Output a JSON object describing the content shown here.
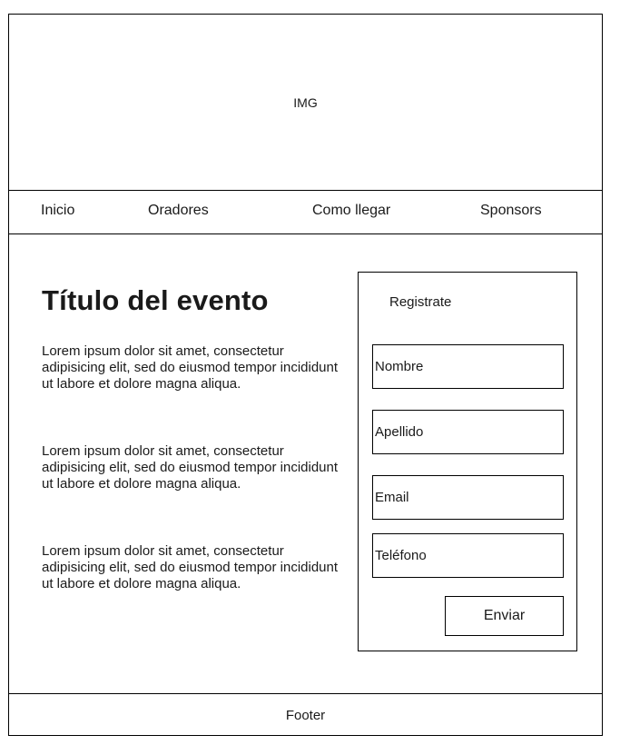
{
  "hero": {
    "label": "IMG"
  },
  "nav": {
    "items": [
      "Inicio",
      "Oradores",
      "Como llegar",
      "Sponsors"
    ]
  },
  "main": {
    "title": "Título del evento",
    "paragraphs": [
      "Lorem ipsum dolor sit amet, consectetur adipisicing elit, sed do eiusmod tempor incididunt ut labore et dolore magna aliqua.",
      "Lorem ipsum dolor sit amet, consectetur adipisicing elit, sed do eiusmod tempor incididunt ut labore et dolore magna aliqua.",
      "Lorem ipsum dolor sit amet, consectetur adipisicing elit, sed do eiusmod tempor incididunt ut labore et dolore magna aliqua."
    ]
  },
  "form": {
    "title": "Registrate",
    "fields": [
      "Nombre",
      "Apellido",
      "Email",
      "Teléfono"
    ],
    "submit_label": "Enviar"
  },
  "footer": {
    "label": "Footer"
  }
}
